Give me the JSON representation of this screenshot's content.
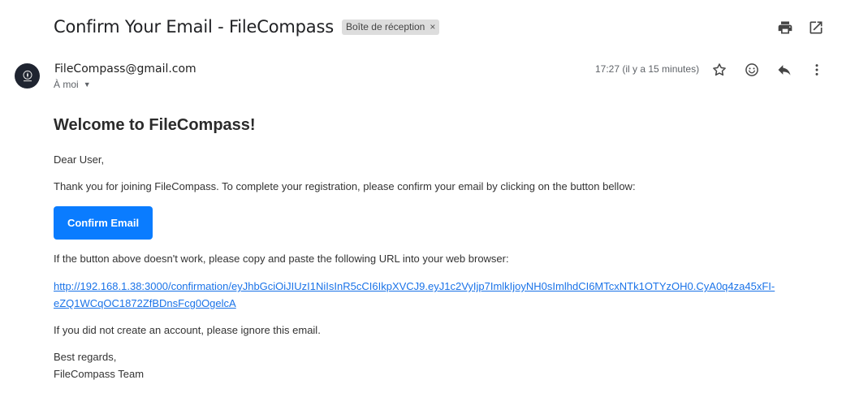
{
  "email": {
    "subject": "Confirm Your Email - FileCompass",
    "label": "Boîte de réception",
    "label_remove": "×",
    "sender": "FileCompass@gmail.com",
    "recipient": "À moi",
    "timestamp": "17:27 (il y a 15 minutes)"
  },
  "icons": {
    "print": "printer-icon",
    "new_window": "open-in-new-window-icon",
    "star": "star-icon",
    "emoji": "emoji-reaction-icon",
    "reply": "reply-icon",
    "more": "more-vertical-icon",
    "dropdown": "chevron-down-icon"
  },
  "body": {
    "heading": "Welcome to FileCompass!",
    "greeting": "Dear User,",
    "intro": "Thank you for joining FileCompass. To complete your registration, please confirm your email by clicking on the button bellow:",
    "button_label": "Confirm Email",
    "fallback_text": "If the button above doesn't work, please copy and paste the following URL into your web browser:",
    "url_line1": "http://192.168.1.38:3000/confirmation/eyJhbGciOiJIUzI1NiIsInR5cCI6IkpXVCJ9.eyJ1c2VyIjp7ImlkIjoyNH0sImlhdCI6MTcxNTk1OTYzOH0.CyA0q4za45xFI-",
    "url_line2": "eZQ1WCqOC1872ZfBDnsFcg0OgelcA",
    "ignore_text": "If you did not create an account, please ignore this email.",
    "closing": "Best regards,",
    "signature": "FileCompass Team"
  },
  "colors": {
    "button": "#0a7cff",
    "link": "#1a73e8",
    "label_chip": "#dddddd"
  }
}
